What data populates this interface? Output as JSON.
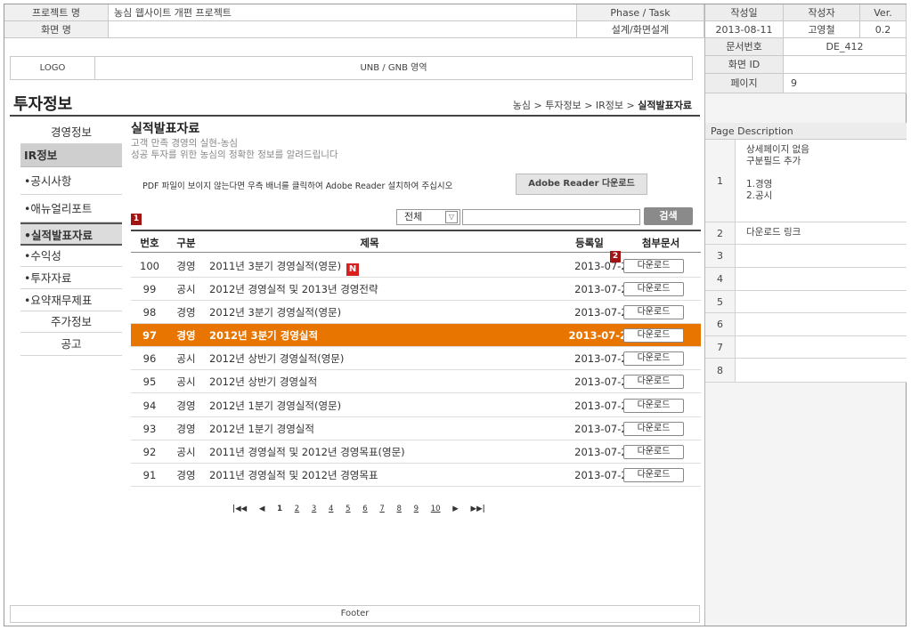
{
  "header": {
    "project_label": "프로젝트 명",
    "project_value": "농심 웹사이트 개편 프로젝트",
    "phase_label": "Phase / Task",
    "phase_value": "설계/화면설계",
    "screen_label": "화면 명",
    "screen_value": "",
    "date_label": "작성일",
    "date_value": "2013-08-11",
    "author_label": "작성자",
    "author_value": "고영철",
    "ver_label": "Ver.",
    "ver_value": "0.2",
    "docno_label": "문서번호",
    "docno_value": "DE_412",
    "screenid_label": "화면 ID",
    "screenid_value": "",
    "page_label": "페이지",
    "page_value": "9"
  },
  "top_bar": {
    "logo": "LOGO",
    "gnb": "UNB / GNB 영역"
  },
  "page_title": "투자정보",
  "breadcrumb": {
    "path": "농심 > 투자정보 > IR정보 > ",
    "current": "실적발표자료"
  },
  "left_nav": {
    "top": "경영정보",
    "section": "IR정보",
    "sub": [
      "•공시사항",
      "•애뉴얼리포트",
      "•실적발표자료",
      "•수익성",
      "•투자자료",
      "•요약재무제표"
    ],
    "bottom": [
      "주가정보",
      "공고"
    ]
  },
  "content": {
    "title": "실적발표자료",
    "sub1": "고객 만족 경영의 실현-농심",
    "sub2": "성공 투자를 위한 농심의 정확한 정보를 알려드립니다",
    "pdf_msg": "PDF 파일이 보이지 않는다면 우측 배너를 클릭하여 Adobe Reader 설치하여 주십시오",
    "adobe_button": "Adobe Reader 다운로드",
    "filter_value": "전체",
    "filter_arrow": "▽",
    "search_button": "검색"
  },
  "markers": {
    "m1": "1",
    "m2": "2"
  },
  "table": {
    "headers": {
      "no": "번호",
      "cat": "구분",
      "title": "제목",
      "date": "등록일",
      "file": "첨부문서"
    },
    "new_badge": "N",
    "rows": [
      {
        "no": "100",
        "cat": "경영",
        "title": "2011년 3분기 경영실적(영문)",
        "date": "2013-07-23",
        "file": "다운로드"
      },
      {
        "no": "99",
        "cat": "공시",
        "title": "2012년 경영실적 및 2013년 경영전략",
        "date": "2013-07-23",
        "file": "다운로드"
      },
      {
        "no": "98",
        "cat": "경영",
        "title": "2012년 3분기 경영실적(영문)",
        "date": "2013-07-23",
        "file": "다운로드"
      },
      {
        "no": "97",
        "cat": "경영",
        "title": "2012년 3분기 경영실적",
        "date": "2013-07-23",
        "file": "다운로드"
      },
      {
        "no": "96",
        "cat": "공시",
        "title": "2012년 상반기 경영실적(영문)",
        "date": "2013-07-23",
        "file": "다운로드"
      },
      {
        "no": "95",
        "cat": "공시",
        "title": "2012년 상반기 경영실적",
        "date": "2013-07-23",
        "file": "다운로드"
      },
      {
        "no": "94",
        "cat": "경영",
        "title": "2012년 1분기 경영실적(영문)",
        "date": "2013-07-23",
        "file": "다운로드"
      },
      {
        "no": "93",
        "cat": "경영",
        "title": "2012년 1분기 경영실적",
        "date": "2013-07-23",
        "file": "다운로드"
      },
      {
        "no": "92",
        "cat": "공시",
        "title": "2011년 경영실적 및 2012년 경영목표(영문)",
        "date": "2013-07-23",
        "file": "다운로드"
      },
      {
        "no": "91",
        "cat": "경영",
        "title": "2011년 경영실적 및 2012년 경영목표",
        "date": "2013-07-23",
        "file": "다운로드"
      }
    ]
  },
  "pager": {
    "first": "|◀◀",
    "prev": "◀",
    "pages": [
      "1",
      "2",
      "3",
      "4",
      "5",
      "6",
      "7",
      "8",
      "9",
      "10"
    ],
    "next": "▶",
    "last": "▶▶|"
  },
  "footer": "Footer",
  "page_description": {
    "title": "Page Description",
    "items": [
      {
        "num": "1",
        "text": "상세페이지 없음\n구분필드 추가\n\n1.경영\n2.공시"
      },
      {
        "num": "2",
        "text": "다운로드 링크"
      },
      {
        "num": "3",
        "text": ""
      },
      {
        "num": "4",
        "text": ""
      },
      {
        "num": "5",
        "text": ""
      },
      {
        "num": "6",
        "text": ""
      },
      {
        "num": "7",
        "text": ""
      },
      {
        "num": "8",
        "text": ""
      }
    ]
  }
}
